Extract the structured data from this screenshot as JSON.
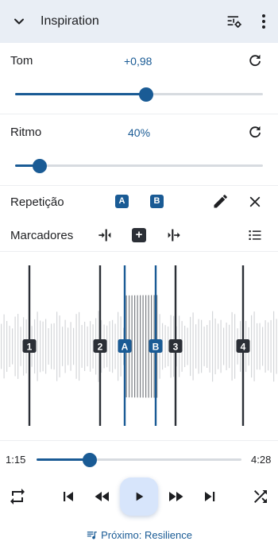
{
  "header": {
    "title": "Inspiration",
    "collapse_icon": "chevron-down-icon",
    "settings_icon": "tune-icon",
    "menu_icon": "more-vert-icon"
  },
  "pitch": {
    "label": "Tom",
    "value": "+0,98",
    "fraction": 0.53
  },
  "tempo": {
    "label": "Ritmo",
    "value": "40%",
    "fraction": 0.1
  },
  "repeat": {
    "label": "Repetição",
    "a_label": "A",
    "b_label": "B"
  },
  "markers": {
    "label": "Marcadores",
    "add_label": "+",
    "items": [
      {
        "label": "1",
        "type": "marker"
      },
      {
        "label": "2",
        "type": "marker"
      },
      {
        "label": "A",
        "type": "loop"
      },
      {
        "label": "B",
        "type": "loop"
      },
      {
        "label": "3",
        "type": "marker"
      },
      {
        "label": "4",
        "type": "marker"
      }
    ]
  },
  "playback": {
    "current_time": "1:15",
    "total_time": "4:28",
    "progress": 0.26
  },
  "next": {
    "text": "Próximo: Resilience"
  },
  "colors": {
    "accent": "#1a5b95",
    "header_bg": "#e9eef5",
    "marker": "#2b2f36",
    "play_bg": "#d7e5fb"
  }
}
